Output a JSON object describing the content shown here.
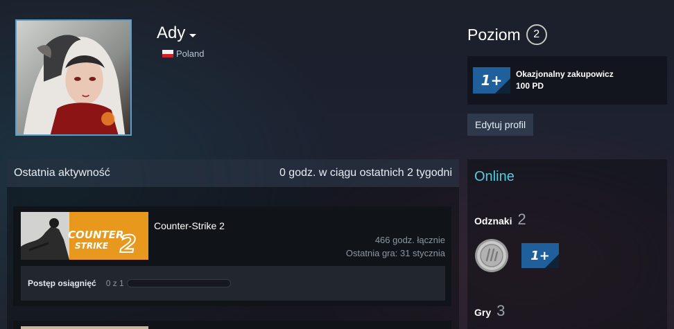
{
  "profile": {
    "name": "Ady",
    "country": "Poland"
  },
  "level": {
    "label": "Poziom",
    "value": "2"
  },
  "featured_badge": {
    "icon": "1plus-badge-icon",
    "title": "Okazjonalny zakupowicz",
    "xp": "100 PD"
  },
  "edit_profile_label": "Edytuj profil",
  "recent_activity": {
    "title": "Ostatnia aktywność",
    "summary": "0 godz. w ciągu ostatnich 2 tygodni",
    "games": [
      {
        "name": "Counter-Strike 2",
        "hours_total": "466 godz. łącznie",
        "last_played": "Ostatnia gra: 31 stycznia",
        "achievements_label": "Postęp osiągnięć",
        "achievements_count": "0 z 1",
        "achievements_progress": 0
      }
    ]
  },
  "sidebar": {
    "status": "Online",
    "badges_label": "Odznaki",
    "badges_count": "2",
    "games_label": "Gry",
    "games_count": "3"
  },
  "colors": {
    "online": "#57cbde",
    "badge_blue": "#1f5f9c",
    "capsule_orange": "#e8981c"
  }
}
